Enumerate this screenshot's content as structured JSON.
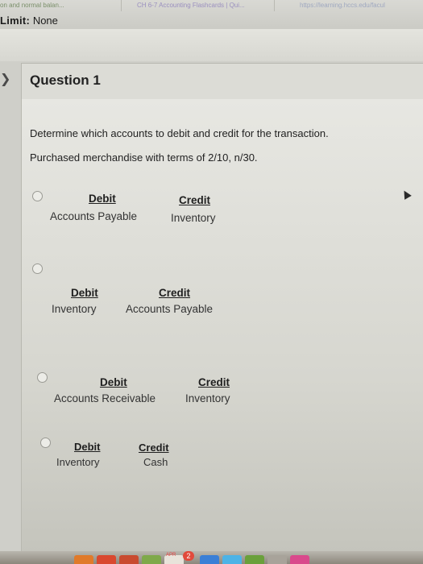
{
  "browser": {
    "tab_1": "on and normal balan...",
    "tab_2": "CH 6-7 Accounting Flashcards | Qui...",
    "tab_3": "https://learning.hccs.edu/facul"
  },
  "header": {
    "time_limit_label": "Limit:",
    "time_limit_value": "None"
  },
  "question": {
    "title": "Question 1",
    "prompt": "Determine which accounts to debit and credit for the transaction.",
    "transaction": "Purchased merchandise with terms of 2/10, n/30."
  },
  "options": [
    {
      "debit_heading": "Debit",
      "debit_account": "Accounts Payable",
      "credit_heading": "Credit",
      "credit_account": "Inventory"
    },
    {
      "debit_heading": "Debit",
      "debit_account": "Inventory",
      "credit_heading": "Credit",
      "credit_account": "Accounts Payable"
    },
    {
      "debit_heading": "Debit",
      "debit_account": "Accounts Receivable",
      "credit_heading": "Credit",
      "credit_account": "Inventory"
    },
    {
      "debit_heading": "Debit",
      "debit_account": "Inventory",
      "credit_heading": "Credit",
      "credit_account": "Cash"
    }
  ],
  "dock": {
    "calendar_month": "APR",
    "notification_badge": "2"
  },
  "colors": {
    "accent_header": "#dcdcd6",
    "badge": "#e24a3b"
  }
}
